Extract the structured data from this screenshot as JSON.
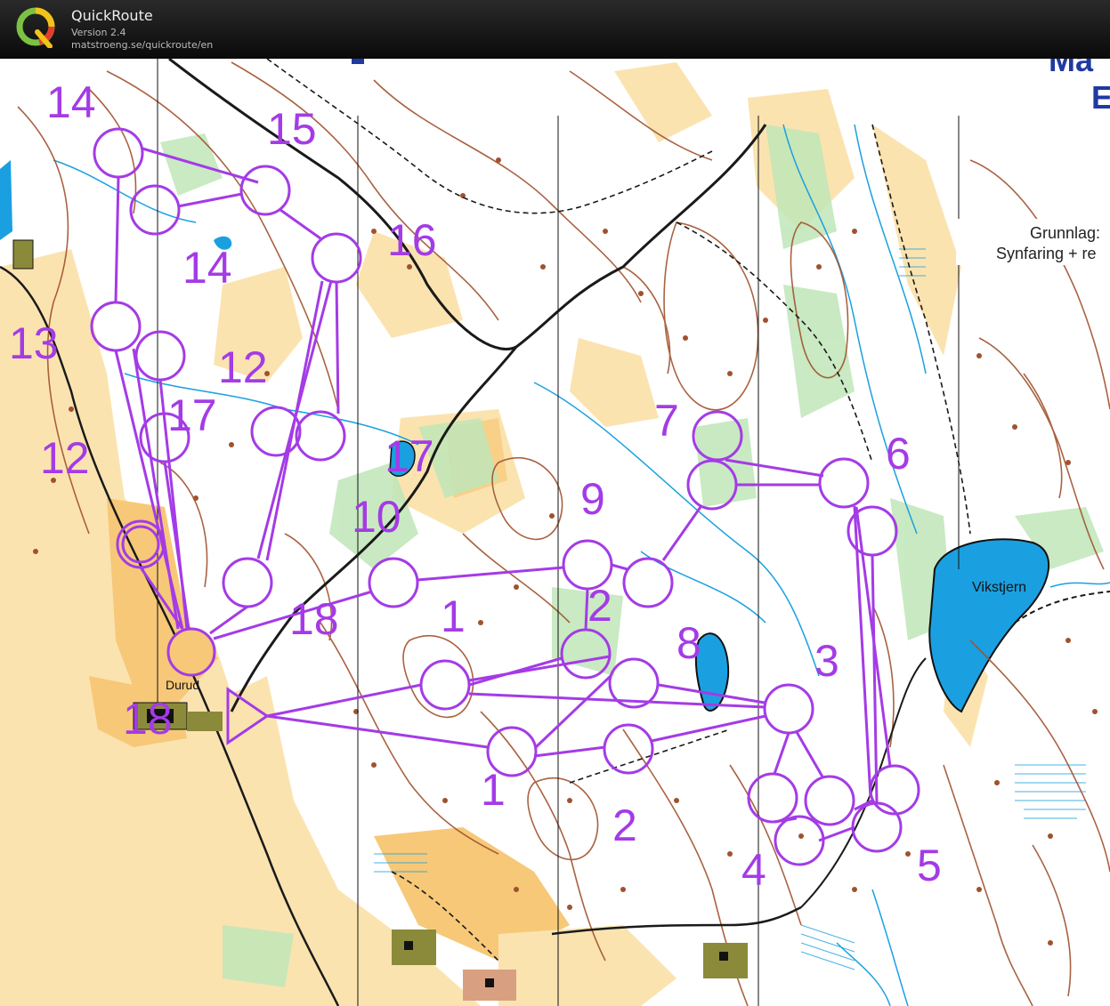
{
  "app": {
    "title": "QuickRoute",
    "version": "Version 2.4",
    "url": "matstroeng.se/quickroute/en"
  },
  "map": {
    "heading_1": "Ma",
    "heading_2": "E",
    "source_label": "Grunnlag:",
    "survey_label": "Synfaring + re",
    "lake_name": "Vikstjern",
    "place_name": "Durud",
    "colors": {
      "course": "#a43be6",
      "open_land": "#f6c878",
      "rough_open": "#fbe3b0",
      "contour": "#a0522d",
      "water": "#1aa0e0",
      "green": "#8fd08a",
      "black": "#1a1a1a"
    },
    "control_numbers": [
      "14",
      "15",
      "16",
      "14",
      "13",
      "12",
      "17",
      "12",
      "17",
      "10",
      "18",
      "1",
      "9",
      "2",
      "7",
      "6",
      "8",
      "3",
      "1",
      "2",
      "4",
      "5",
      "18"
    ]
  }
}
